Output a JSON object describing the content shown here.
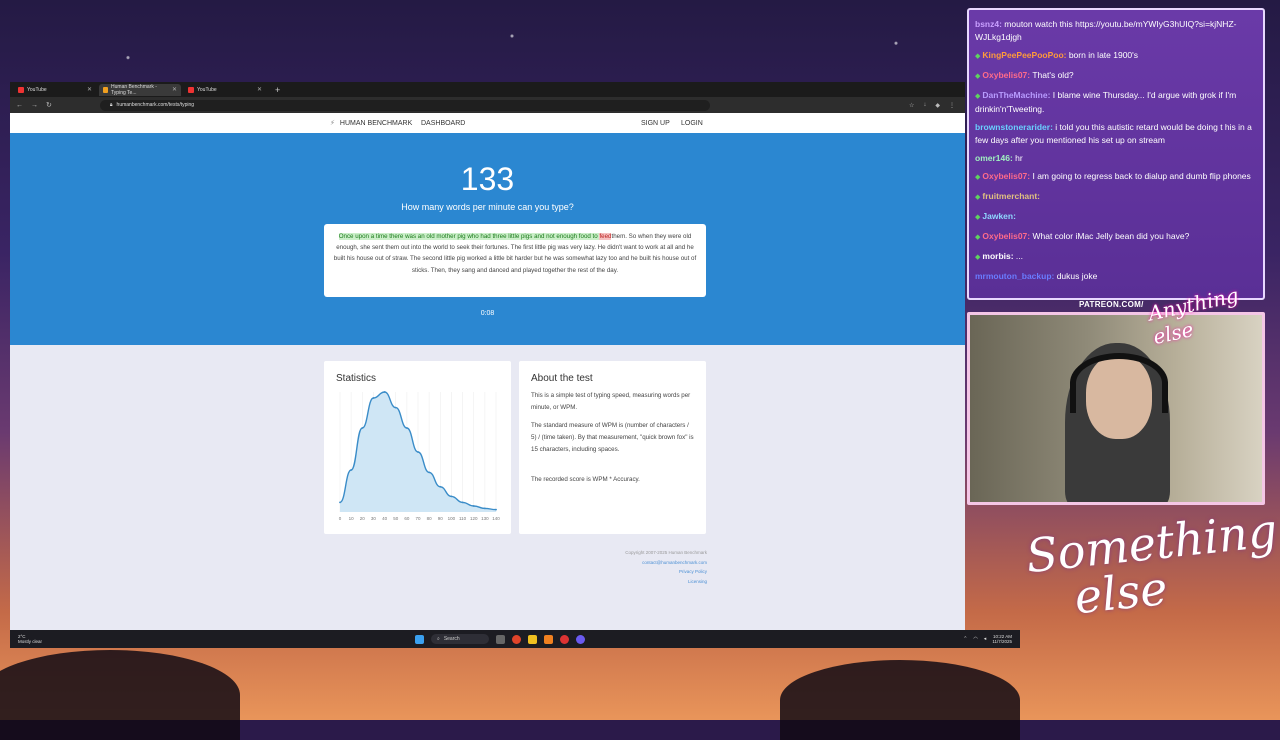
{
  "browser": {
    "tabs": [
      {
        "label": "YouTube",
        "active": false
      },
      {
        "label": "Human Benchmark - Typing Te...",
        "active": true
      },
      {
        "label": "YouTube",
        "active": false
      }
    ],
    "url": "humanbenchmark.com/tests/typing"
  },
  "site": {
    "nav": {
      "brand": "HUMAN BENCHMARK",
      "dashboard": "DASHBOARD",
      "signup": "SIGN UP",
      "login": "LOGIN"
    },
    "hero": {
      "score": "133",
      "question": "How many words per minute can you type?",
      "typed_text": "Once upon a time there was an old mother pig who had three little pigs and not enough food to ",
      "error_text": "feed",
      "remaining_text": "them. So when they were old enough, she sent them out into the world to seek their fortunes. The first little pig was very lazy. He didn't want to work at all and he built his house out of straw. The second little pig worked a little bit harder but he was somewhat lazy too and he built his house out of sticks. Then, they sang and danced and played together the rest of the day.",
      "timer": "0:08"
    },
    "statistics": {
      "title": "Statistics",
      "x_ticks": [
        "0",
        "10",
        "20",
        "30",
        "40",
        "50",
        "60",
        "70",
        "80",
        "90",
        "100",
        "110",
        "120",
        "130",
        "140"
      ]
    },
    "about": {
      "title": "About the test",
      "p1": "This is a simple test of typing speed, measuring words per minute, or WPM.",
      "p2": "The standard measure of WPM is (number of characters / 5) / (time taken). By that measurement, \"quick brown fox\" is 15 characters, including spaces.",
      "p3": "The recorded score is WPM * Accuracy."
    },
    "footer": {
      "copyright": "Copyright 2007-2025 Human Benchmark",
      "email": "contact@humanbenchmark.com",
      "privacy": "Privacy Policy",
      "licensing": "Licensing"
    }
  },
  "chart_data": {
    "type": "area",
    "x": [
      0,
      10,
      20,
      30,
      40,
      50,
      60,
      70,
      80,
      90,
      100,
      110,
      120,
      130,
      140
    ],
    "values": [
      0.08,
      0.35,
      0.7,
      0.95,
      1.0,
      0.87,
      0.7,
      0.5,
      0.33,
      0.21,
      0.13,
      0.08,
      0.05,
      0.03,
      0.02
    ],
    "xlim": [
      0,
      140
    ],
    "grid": true,
    "title": "Statistics"
  },
  "taskbar": {
    "weather_temp": "2°C",
    "weather_desc": "Mostly clear",
    "search": "Search",
    "time": "10:22 AM",
    "date": "11/7/2025"
  },
  "chat": {
    "messages": [
      {
        "user": "bsnz4:",
        "text": "mouton watch this https://youtu.be/mYWIyG3hUIQ?si=kjNHZ-WJLkg1djgh",
        "color": "#c9a0ff",
        "badge": false
      },
      {
        "user": "KingPeePeePooPoo:",
        "text": "born in late 1900's",
        "color": "#ff9a3a",
        "badge": true
      },
      {
        "user": "Oxybelis07:",
        "text": "That's old?",
        "color": "#ff6b8a",
        "badge": true
      },
      {
        "user": "DanTheMachine:",
        "text": "I blame wine Thursday... I'd argue with grok if I'm drinkin'n'Tweeting.",
        "color": "#b89cff",
        "badge": true
      },
      {
        "user": "brownstonerarider:",
        "text": "i told you this autistic retard would be doing t his in a few days after you mentioned his set up on stream",
        "color": "#6ad0ff",
        "badge": false
      },
      {
        "user": "omer146:",
        "text": "hr",
        "color": "#9ff0c0",
        "badge": false
      },
      {
        "user": "Oxybelis07:",
        "text": "I am going to regress back to dialup and dumb flip phones",
        "color": "#ff6b8a",
        "badge": true
      },
      {
        "user": "fruitmerchant:",
        "text": "",
        "color": "#e0c080",
        "badge": true
      },
      {
        "user": "Jawken:",
        "text": "",
        "color": "#8fd8ff",
        "badge": true
      },
      {
        "user": "Oxybelis07:",
        "text": "What color iMac Jelly bean did you have?",
        "color": "#ff6b8a",
        "badge": true
      },
      {
        "user": "morbis:",
        "text": "...",
        "color": "#ffffff",
        "badge": true
      },
      {
        "user": "mrmouton_backup:",
        "text": "dukus joke",
        "color": "#6a7cff",
        "badge": false
      }
    ]
  },
  "overlay": {
    "patreon": "PATREON.COM/",
    "logo_small": "Anything else",
    "logo_big_1": "Something",
    "logo_big_2": "else"
  }
}
